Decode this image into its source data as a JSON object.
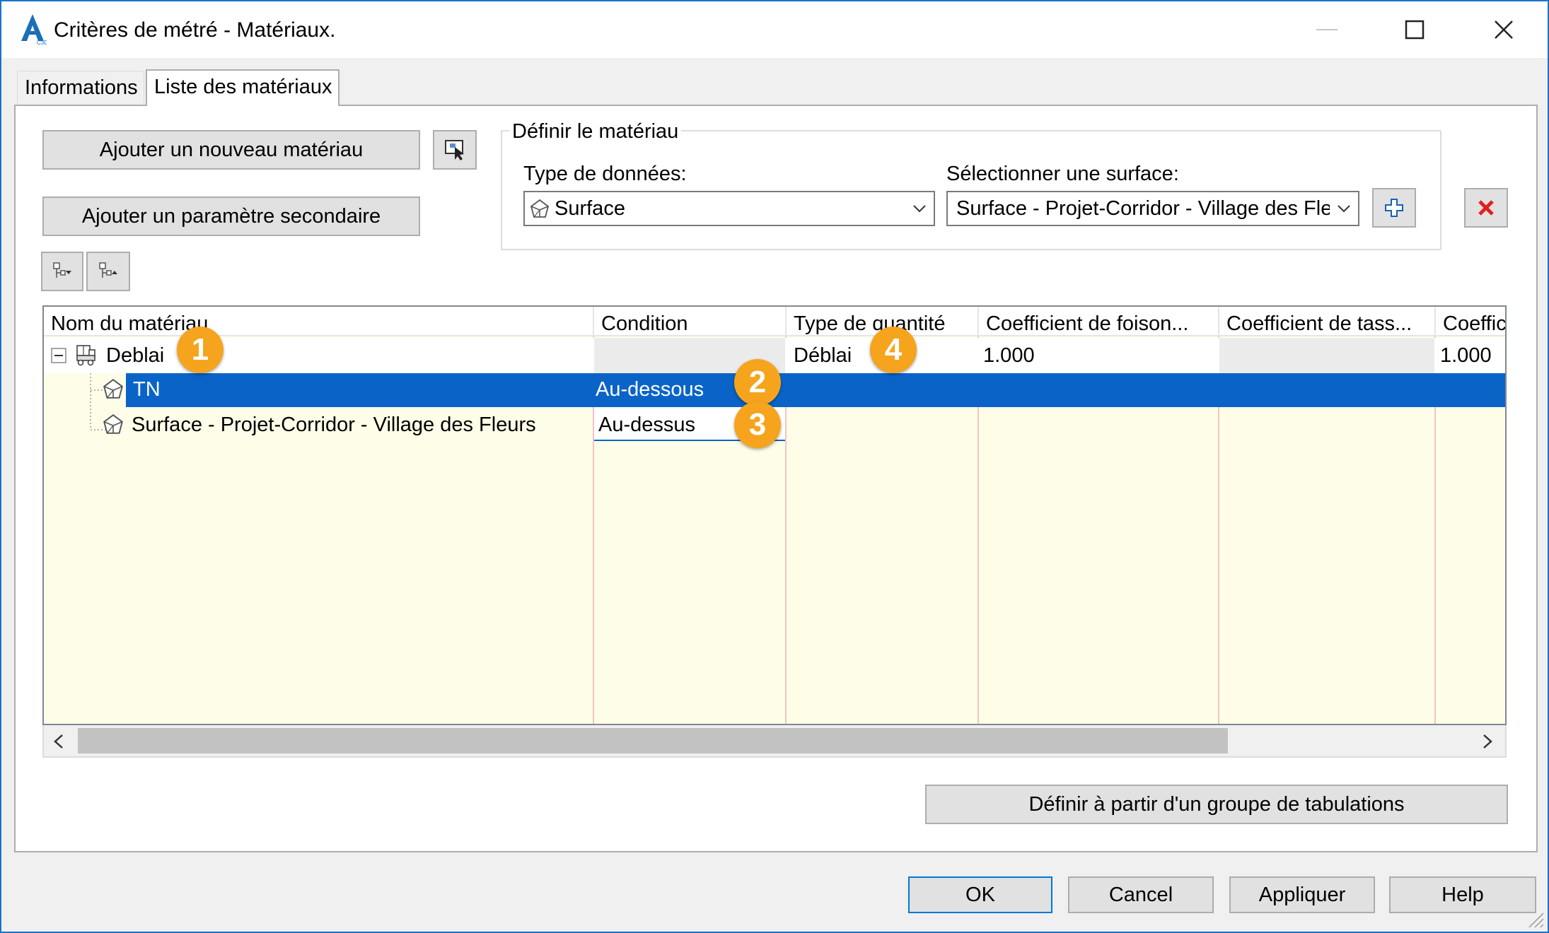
{
  "window": {
    "title": "Critères de métré - Matériaux.",
    "app_icon": "autocad-civil3d-icon",
    "controls": [
      "minimize-icon",
      "maximize-icon",
      "close-icon"
    ]
  },
  "tabs": [
    {
      "label": "Informations",
      "active": false
    },
    {
      "label": "Liste des matériaux",
      "active": true
    }
  ],
  "toolbar": {
    "add_material_label": "Ajouter un nouveau matériau",
    "add_secondary_label": "Ajouter un paramètre secondaire",
    "pick_icon": "pick-from-drawing-icon",
    "expand_icon": "tree-expand-icon",
    "collapse_icon": "tree-collapse-icon"
  },
  "define_material": {
    "legend": "Définir le matériau",
    "data_type_label": "Type de données:",
    "data_type_value": "Surface",
    "surface_label": "Sélectionner une surface:",
    "surface_value": "Surface - Projet-Corridor - Village des Fle",
    "add_icon": "add-plus-icon",
    "delete_icon": "delete-x-icon",
    "delete_color": "#e02020"
  },
  "grid": {
    "columns": [
      "Nom du matériau",
      "Condition",
      "Type de quantité",
      "Coefficient de foison...",
      "Coefficient de tass...",
      "Coeffic"
    ],
    "rows": [
      {
        "name": "Deblai",
        "condition": "",
        "quantity_type": "Déblai",
        "coef_foison": "1.000",
        "coef_tass": "",
        "coef": "1.000",
        "icon": "material-icon",
        "expanded": true
      },
      {
        "name": "TN",
        "condition": "Au-dessous",
        "quantity_type": "",
        "coef_foison": "",
        "coef_tass": "",
        "coef": "",
        "icon": "surface-icon",
        "selected": true
      },
      {
        "name": "Surface - Projet-Corridor - Village des Fleurs",
        "condition": "Au-dessus",
        "quantity_type": "",
        "coef_foison": "",
        "coef_tass": "",
        "coef": "",
        "icon": "surface-icon"
      }
    ],
    "selection_color": "#0a64c8",
    "row_background": "#fefee8"
  },
  "callouts": [
    "1",
    "2",
    "3",
    "4"
  ],
  "callout_color": "#f6a41d",
  "footer": {
    "tab_group_label": "Définir à partir d'un groupe de tabulations",
    "ok_label": "OK",
    "cancel_label": "Cancel",
    "apply_label": "Appliquer",
    "help_label": "Help"
  }
}
